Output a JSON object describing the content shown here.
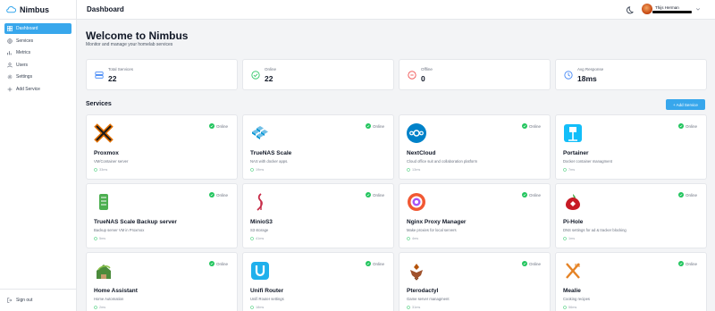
{
  "app": {
    "name": "Nimbus"
  },
  "sidebar": {
    "items": [
      {
        "label": "Dashboard",
        "icon": "dashboard-icon"
      },
      {
        "label": "Services",
        "icon": "services-icon"
      },
      {
        "label": "Metrics",
        "icon": "metrics-icon"
      },
      {
        "label": "Users",
        "icon": "users-icon"
      },
      {
        "label": "Settings",
        "icon": "settings-icon"
      },
      {
        "label": "Add Service",
        "icon": "plus-icon"
      }
    ],
    "signout_label": "Sign out"
  },
  "header": {
    "title": "Dashboard",
    "user_name": "Thijs Herman"
  },
  "main": {
    "welcome": "Welcome to Nimbus",
    "subtitle": "Monitor and manage your homelab services"
  },
  "stats": [
    {
      "label": "Total Services",
      "value": "22",
      "icon": "server-icon",
      "color": "#3b82f6"
    },
    {
      "label": "Online",
      "value": "22",
      "icon": "check-circle-icon",
      "color": "#22c55e"
    },
    {
      "label": "Offline",
      "value": "0",
      "icon": "x-circle-icon",
      "color": "#ef4444"
    },
    {
      "label": "Avg Response",
      "value": "18ms",
      "icon": "clock-icon",
      "color": "#3b82f6"
    }
  ],
  "services_section": {
    "title": "Services",
    "add_button": "+ Add Service"
  },
  "services": [
    {
      "name": "Proxmox",
      "description": "VM/Container server",
      "status": "Online",
      "latency": "33ms",
      "icon": "proxmox-icon"
    },
    {
      "name": "TrueNAS Scale",
      "description": "NAS with docker apps.",
      "status": "Online",
      "latency": "19ms",
      "icon": "truenas-icon"
    },
    {
      "name": "NextCloud",
      "description": "Cloud office suit and collaboration platform",
      "status": "Online",
      "latency": "13ms",
      "icon": "nextcloud-icon"
    },
    {
      "name": "Portainer",
      "description": "Docker container managment",
      "status": "Online",
      "latency": "7ms",
      "icon": "portainer-icon"
    },
    {
      "name": "TrueNAS Scale Backup server",
      "description": "Backup server VM in Proxmox",
      "status": "Online",
      "latency": "5ms",
      "icon": "truenas-backup-icon"
    },
    {
      "name": "MinioS3",
      "description": "S3 storage",
      "status": "Online",
      "latency": "41ms",
      "icon": "minio-icon"
    },
    {
      "name": "Nginx Proxy Manager",
      "description": "Make proxies for local servers",
      "status": "Online",
      "latency": "4ms",
      "icon": "nginx-proxy-manager-icon"
    },
    {
      "name": "Pi-Hole",
      "description": "DNS settings for ad & tracker blocking",
      "status": "Online",
      "latency": "1ms",
      "icon": "pihole-icon"
    },
    {
      "name": "Home Assistant",
      "description": "Home Automation",
      "status": "Online",
      "latency": "2ms",
      "icon": "home-assistant-icon"
    },
    {
      "name": "Unifi Router",
      "description": "Unifi Router settings",
      "status": "Online",
      "latency": "18ms",
      "icon": "unifi-icon"
    },
    {
      "name": "Pterodactyl",
      "description": "Game server managment",
      "status": "Online",
      "latency": "31ms",
      "icon": "pterodactyl-icon"
    },
    {
      "name": "Mealie",
      "description": "Cooking recipes",
      "status": "Online",
      "latency": "56ms",
      "icon": "mealie-icon"
    }
  ],
  "colors": {
    "accent": "#38a7ec",
    "online": "#22c55e",
    "offline": "#ef4444"
  }
}
